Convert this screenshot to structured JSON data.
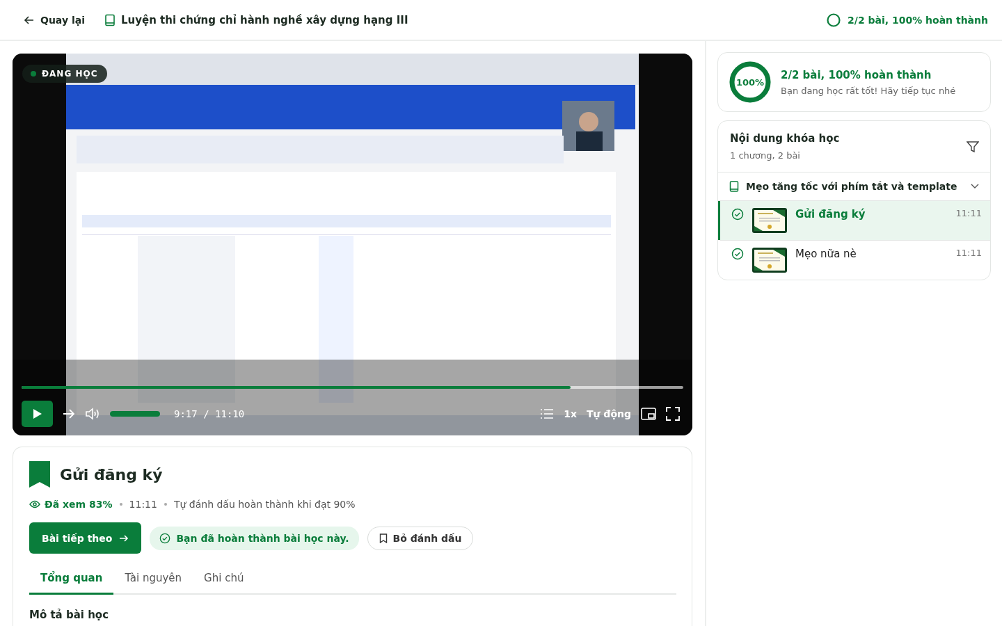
{
  "header": {
    "back_label": "Quay lại",
    "course_title": "Luyện thi chứng chỉ hành nghề xây dựng hạng III",
    "progress_text": "2/2 bài, 100% hoàn thành"
  },
  "video": {
    "kind": "picture",
    "badge": "ĐANG HỌC",
    "progress": {
      "level": 0.83
    },
    "volume": {
      "level": 1
    },
    "current_time": "9:17",
    "separator": "/",
    "duration": "11:10",
    "speed": "1x",
    "quality": "Tự động"
  },
  "lesson": {
    "title": "Gửi đăng ký",
    "watched": "Đã xem 83%",
    "duration": "11:11",
    "auto_complete": "Tự đánh dấu hoàn thành khi đạt 90%",
    "next_button": "Bài tiếp theo",
    "completed_notice": "Bạn đã hoàn thành bài học này.",
    "bookmark_button": "Bỏ đánh dấu",
    "tabs": [
      {
        "label": "Tổng quan",
        "selected": true
      },
      {
        "label": "Tài nguyên",
        "selected": false
      },
      {
        "label": "Ghi chú",
        "selected": false
      }
    ],
    "section_heading": "Mô tả bài học"
  },
  "sidebar": {
    "summary": {
      "percent": "100%",
      "level": 1,
      "title": "2/2 bài, 100% hoàn thành",
      "subtitle": "Bạn đang học rất tốt! Hãy tiếp tục nhé"
    },
    "content": {
      "title": "Nội dung khóa học",
      "subtitle": "1 chương, 2 bài",
      "chapter": {
        "title": "Mẹo tăng tốc với phím tắt và template",
        "expanded": true,
        "lessons": [
          {
            "title": "Gửi đăng ký",
            "duration": "11:11",
            "completed": true,
            "selected": true
          },
          {
            "title": "Mẹo nữa nè",
            "duration": "11:11",
            "completed": true,
            "selected": false
          }
        ]
      }
    }
  }
}
